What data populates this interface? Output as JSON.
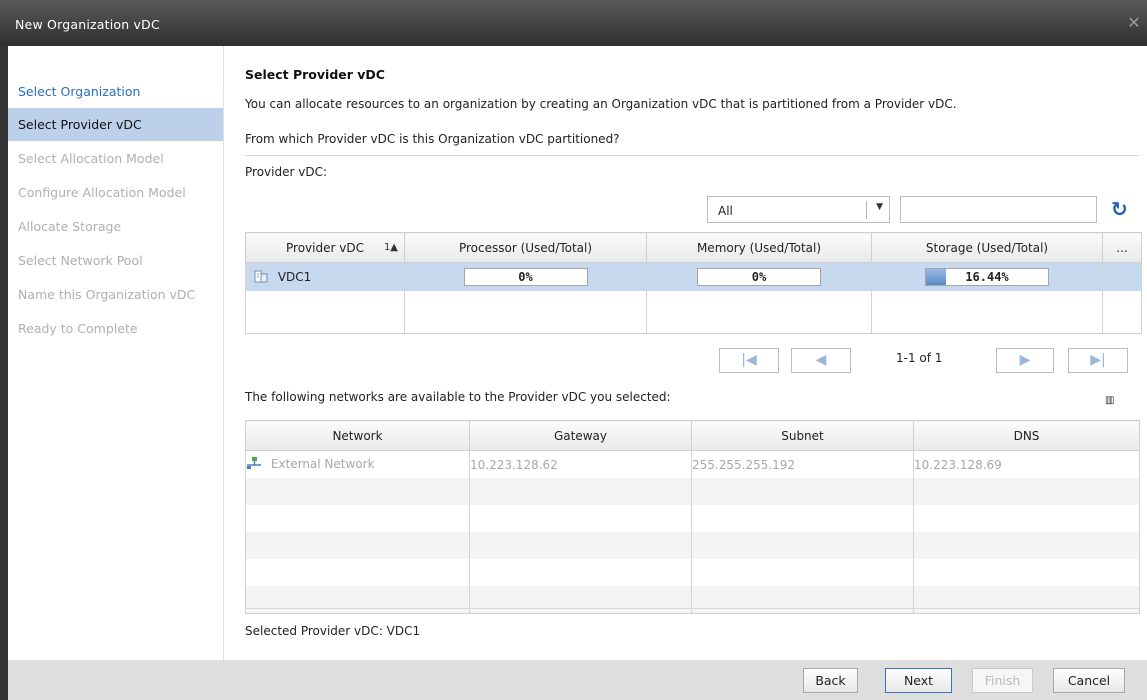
{
  "window": {
    "title": "New Organization vDC",
    "close_glyph": "✕"
  },
  "sidebar": {
    "steps": [
      {
        "label": "Select Organization",
        "state": "link"
      },
      {
        "label": "Select Provider vDC",
        "state": "active"
      },
      {
        "label": "Select Allocation Model",
        "state": "disabled"
      },
      {
        "label": "Configure Allocation Model",
        "state": "disabled"
      },
      {
        "label": "Allocate Storage",
        "state": "disabled"
      },
      {
        "label": "Select Network Pool",
        "state": "disabled"
      },
      {
        "label": "Name this Organization vDC",
        "state": "disabled"
      },
      {
        "label": "Ready to Complete",
        "state": "disabled"
      }
    ]
  },
  "main": {
    "heading": "Select Provider vDC",
    "intro": "You can allocate resources to an organization by creating an Organization vDC that is partitioned from a Provider vDC.",
    "question": "From which Provider vDC is this Organization vDC partitioned?",
    "provider_label": "Provider vDC:",
    "filter": {
      "selected": "All",
      "arrow": "▼"
    },
    "search": {
      "value": "",
      "placeholder": ""
    },
    "refresh_glyph": "↻",
    "provider_table": {
      "columns": [
        "Provider vDC",
        "Processor (Used/Total)",
        "Memory (Used/Total)",
        "Storage (Used/Total)"
      ],
      "sort_indicator": "1▲",
      "more_glyph": "...",
      "rows": [
        {
          "name": "VDC1",
          "processor": "0%",
          "processor_fraction": 0,
          "memory": "0%",
          "memory_fraction": 0,
          "storage": "16.44%",
          "storage_fraction": 0.1644
        }
      ]
    },
    "pager": {
      "first_glyph": "|◀",
      "prev_glyph": "◀",
      "next_glyph": "▶",
      "last_glyph": "▶|",
      "text": "1-1 of 1"
    },
    "networks_label": "The following networks are available to the Provider vDC you selected:",
    "column_chooser_glyph": "▥",
    "network_table": {
      "columns": [
        "Network",
        "Gateway",
        "Subnet",
        "DNS"
      ],
      "rows": [
        {
          "network": "External Network",
          "gateway": "10.223.128.62",
          "subnet": "255.255.255.192",
          "dns": "10.223.128.69"
        }
      ]
    },
    "selected_provider": "Selected Provider vDC: VDC1"
  },
  "footer": {
    "back_label": "Back",
    "next_label": "Next",
    "finish_label": "Finish",
    "cancel_label": "Cancel"
  },
  "colors": {
    "accent": "#1f63b5",
    "selected_row": "#c7d9ef",
    "active_step": "#bcd0ea",
    "link": "#2a6eb8"
  }
}
